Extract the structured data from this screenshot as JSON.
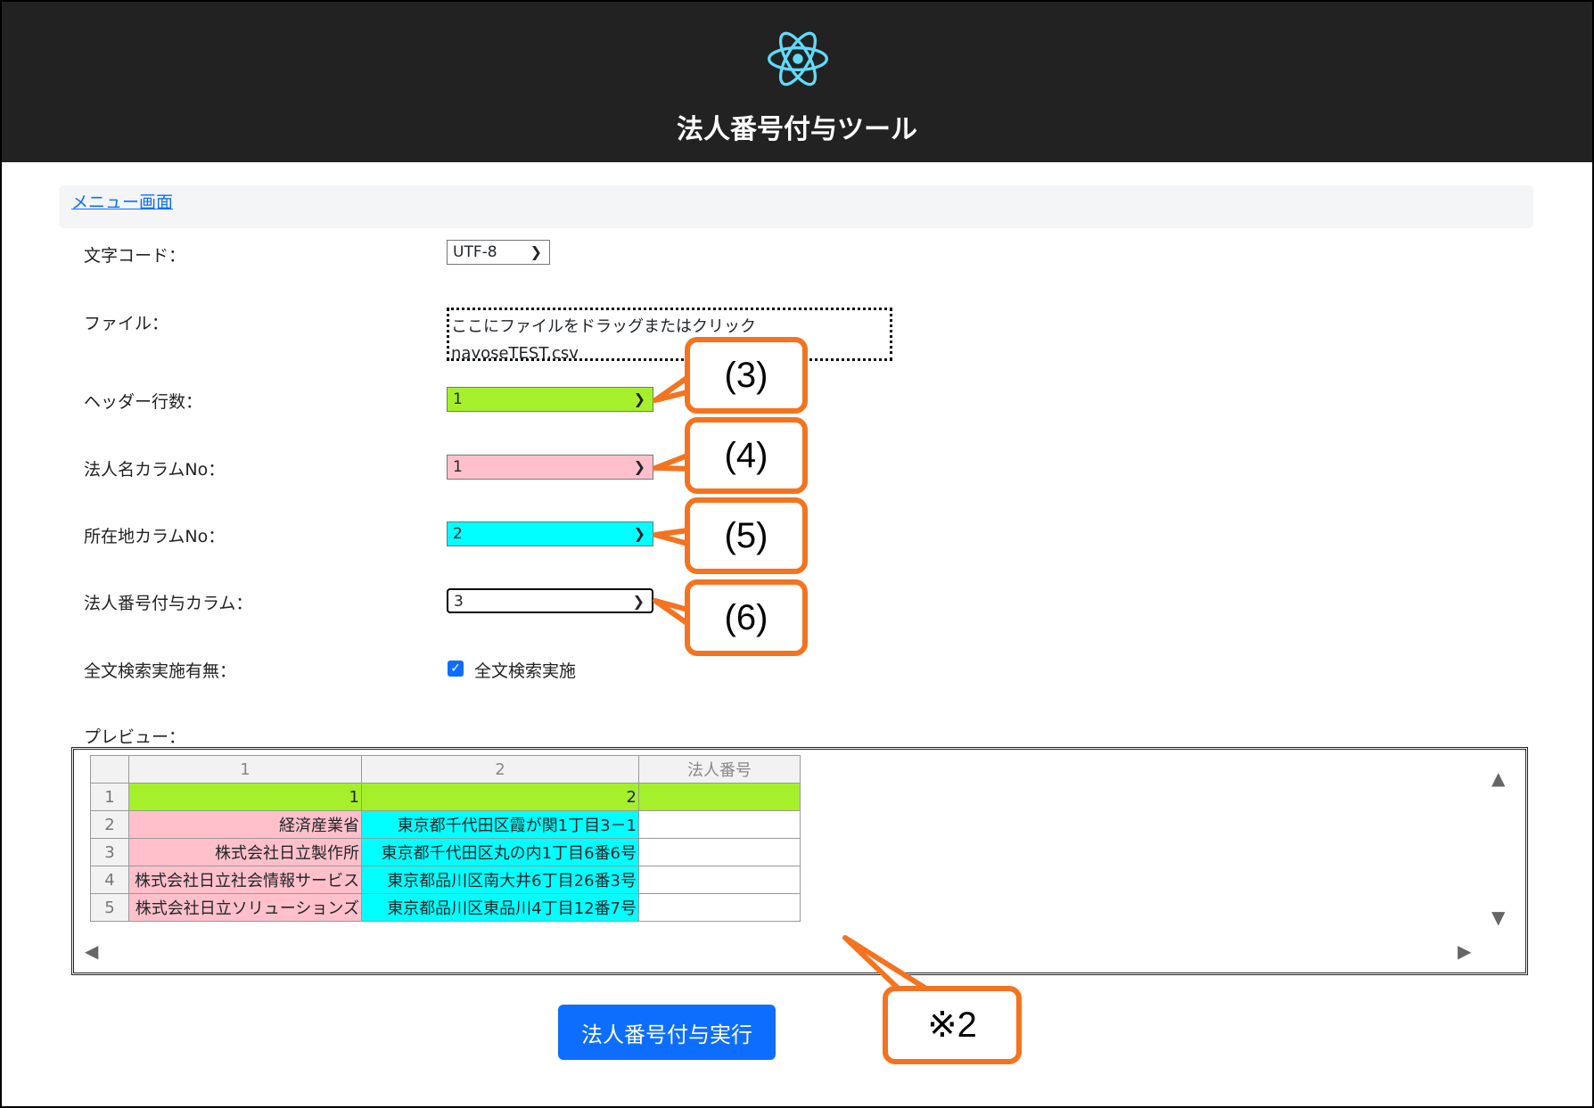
{
  "header": {
    "title": "法人番号付与ツール",
    "logo_icon": "react-atom-icon"
  },
  "nav": {
    "menu_link": "メニュー画面"
  },
  "form": {
    "encoding_label": "文字コード：",
    "encoding_value": "UTF-8",
    "file_label": "ファイル：",
    "file_drop_text": "ここにファイルをドラッグまたはクリック",
    "file_name": "nayoseTEST.csv",
    "header_rows_label": "ヘッダー行数：",
    "header_rows_value": "1",
    "name_col_label": "法人名カラムNo：",
    "name_col_value": "1",
    "address_col_label": "所在地カラムNo：",
    "address_col_value": "2",
    "number_col_label": "法人番号付与カラム：",
    "number_col_value": "3",
    "fulltext_label": "全文検索実施有無：",
    "fulltext_checkbox_label": "全文検索実施",
    "fulltext_checked": true,
    "preview_label": "プレビュー："
  },
  "preview": {
    "columns": [
      "1",
      "2",
      "法人番号"
    ],
    "rows": [
      {
        "num": "1",
        "c1": "1",
        "c2": "2",
        "c3": ""
      },
      {
        "num": "2",
        "c1": "経済産業省",
        "c2": "東京都千代田区霞が関1丁目3－1",
        "c3": ""
      },
      {
        "num": "3",
        "c1": "株式会社日立製作所",
        "c2": "東京都千代田区丸の内1丁目6番6号",
        "c3": ""
      },
      {
        "num": "4",
        "c1": "株式会社日立社会情報サービス",
        "c2": "東京都品川区南大井6丁目26番3号",
        "c3": ""
      },
      {
        "num": "5",
        "c1": "株式会社日立ソリューションズ",
        "c2": "東京都品川区東品川4丁目12番7号",
        "c3": ""
      }
    ]
  },
  "execute_button": "法人番号付与実行",
  "callouts": [
    "(3)",
    "(4)",
    "(5)",
    "(6)",
    "※2"
  ],
  "colors": {
    "header_rows": "#a5f02b",
    "name_col": "#ffc0cb",
    "address_col": "#00ffff",
    "callout": "#f47320",
    "button": "#0d6efd"
  }
}
